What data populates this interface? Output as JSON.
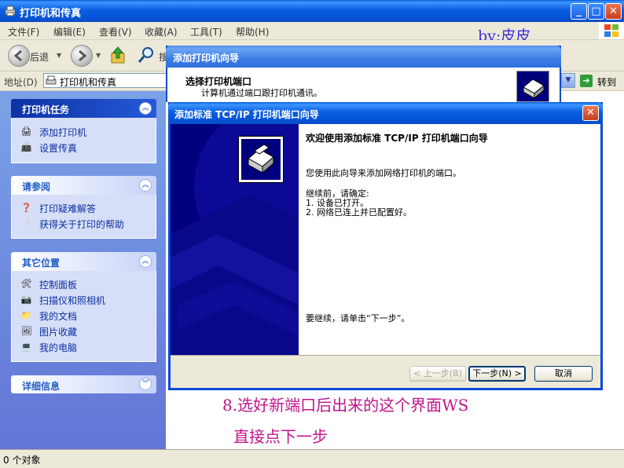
{
  "window": {
    "title": "打印机和传真",
    "minimize_glyph": "_",
    "maximize_glyph": "□",
    "close_glyph": "✕"
  },
  "menu": [
    "文件(F)",
    "编辑(E)",
    "查看(V)",
    "收藏(A)",
    "工具(T)",
    "帮助(H)"
  ],
  "byline": "by;皮皮",
  "toolbar": {
    "back_label": "后退",
    "partial_label": "搜"
  },
  "address": {
    "label": "地址(D)",
    "value": "打印机和传真",
    "go_label": "转到"
  },
  "taskpane": {
    "printer_tasks": {
      "title": "打印机任务",
      "items": [
        "添加打印机",
        "设置传真"
      ]
    },
    "see_also": {
      "title": "请参阅",
      "items": [
        "打印疑难解答",
        "获得关于打印的帮助"
      ]
    },
    "other_places": {
      "title": "其它位置",
      "items": [
        "控制面板",
        "扫描仪和照相机",
        "我的文档",
        "图片收藏",
        "我的电脑"
      ]
    },
    "details": {
      "title": "详细信息"
    }
  },
  "status": {
    "text": "0 个对象"
  },
  "add_printer_wizard": {
    "title": "添加打印机向导",
    "heading": "选择打印机端口",
    "subheading": "计算机通过端口跟打印机通讯。"
  },
  "tcpip_wizard": {
    "title": "添加标准 TCP/IP 打印机端口向导",
    "heading": "欢迎使用添加标准 TCP/IP 打印机端口向导",
    "intro": "您使用此向导来添加网络打印机的端口。",
    "before": "继续前，请确定:",
    "step1": "1.  设备已打开。",
    "step2": "2.  网络已连上并已配置好。",
    "continue": "要继续，请单击“下一步”。",
    "back_button": "< 上一步(B)",
    "next_button": "下一步(N) >",
    "cancel_button": "取消"
  },
  "annotation": {
    "line1": "8.选好新端口后出来的这个界面WS",
    "line2": "直接点下一步"
  },
  "colors": {
    "titlebar": "#0553d6",
    "wizard_side": "#00007e",
    "annotation": "#c0148c",
    "byline": "#3b2cd7"
  }
}
